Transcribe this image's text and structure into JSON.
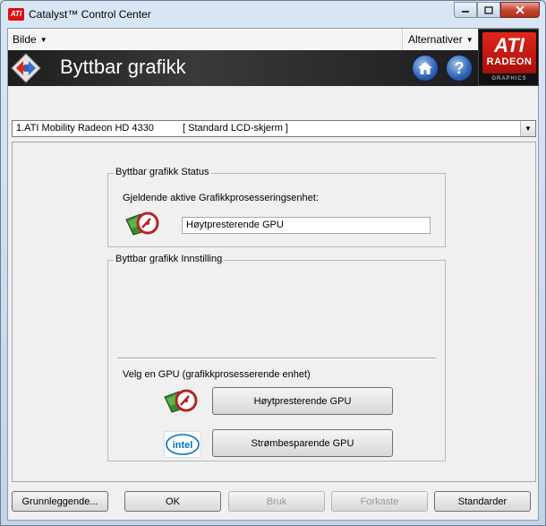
{
  "window": {
    "app_icon_text": "ATI",
    "title": "Catalyst™ Control Center"
  },
  "menubar": {
    "left_menu": "Bilde",
    "right_menu": "Alternativer"
  },
  "logo": {
    "brand": "ATI",
    "product": "RADEON",
    "sub": "GRAPHICS"
  },
  "header": {
    "title": "Byttbar grafikk"
  },
  "device": {
    "name": "1.ATI Mobility Radeon HD 4330",
    "display": "[ Standard LCD-skjerm ]"
  },
  "status_group": {
    "legend": "Byttbar grafikk Status",
    "current_label": "Gjeldende aktive Grafikkprosesseringsenhet:",
    "current_value": "Høytpresterende GPU"
  },
  "settings_group": {
    "legend": "Byttbar grafikk Innstilling",
    "choose_label": "Velg en GPU (grafikkprosesserende enhet)",
    "high_perf_button": "Høytpresterende GPU",
    "power_saving_button": "Strømbesparende GPU",
    "intel_logo_text": "intel"
  },
  "bottom_bar": {
    "basic": "Grunnleggende...",
    "ok": "OK",
    "apply": "Bruk",
    "discard": "Forkaste",
    "defaults": "Standarder"
  },
  "colors": {
    "ati_red": "#d11f14",
    "header_bg": "#1d1d1d",
    "intel_blue": "#0071c5"
  }
}
